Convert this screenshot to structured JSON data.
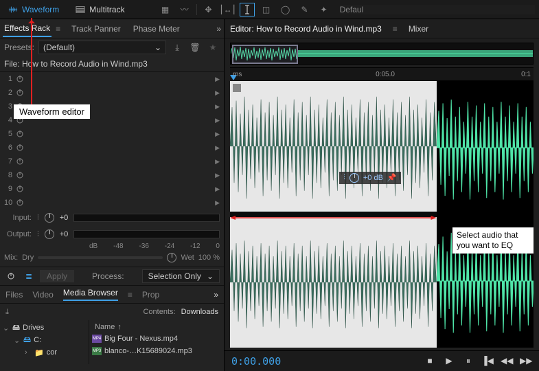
{
  "topbar": {
    "waveform_label": "Waveform",
    "multitrack_label": "Multitrack",
    "right_label": "Defaul"
  },
  "effects_rack": {
    "tabs": {
      "effects_rack": "Effects Rack",
      "track_panner": "Track Panner",
      "phase_meter": "Phase Meter"
    },
    "presets_label": "Presets:",
    "presets_value": "(Default)",
    "file_prefix": "File:",
    "file_name": "How to Record Audio in Wind.mp3",
    "slots": [
      "1",
      "2",
      "3",
      "4",
      "5",
      "6",
      "7",
      "8",
      "9",
      "10"
    ],
    "input_label": "Input:",
    "input_value": "+0",
    "output_label": "Output:",
    "output_value": "+0",
    "db_scale": [
      "dB",
      "-48",
      "-36",
      "-24",
      "-12",
      "0"
    ],
    "mix_label": "Mix:",
    "mix_dry": "Dry",
    "mix_wet": "Wet",
    "mix_value": "100 %",
    "apply_label": "Apply",
    "process_label": "Process:",
    "process_value": "Selection Only"
  },
  "browser": {
    "tabs": {
      "files": "Files",
      "video": "Video",
      "media_browser": "Media Browser",
      "prop": "Prop"
    },
    "contents_label": "Contents:",
    "contents_value": "Downloads",
    "tree_drives": "Drives",
    "tree_c": "C:",
    "tree_cor": "cor",
    "col_name": "Name",
    "files_list": [
      {
        "icon": "MP4",
        "name": "Big Four - Nexus.mp4"
      },
      {
        "icon": "MP3",
        "name": "blanco-…K15689024.mp3"
      }
    ]
  },
  "editor": {
    "tab_prefix": "Editor:",
    "tab_file": "How to Record Audio in Wind.mp3",
    "mixer_label": "Mixer",
    "ruler": {
      "t0": "ms",
      "t1": "0:05.0",
      "t2": "0:1"
    },
    "float_db": "+0 dB",
    "timecode": "0:00.000"
  },
  "annotations": {
    "waveform_editor": "Waveform editor",
    "select_eq_l1": "Select audio that",
    "select_eq_l2": "you want to EQ"
  },
  "colors": {
    "accent": "#3fa0e6",
    "wave_green": "#4fe4a8",
    "wave_dark": "#3a6e5e",
    "annotation_red": "#e02020"
  }
}
